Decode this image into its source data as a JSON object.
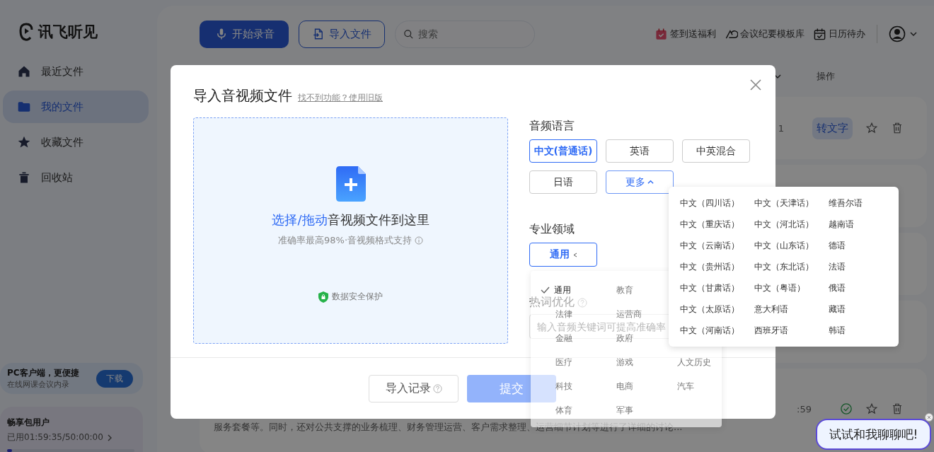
{
  "app": {
    "logo_text": "讯飞听见"
  },
  "sidebar": {
    "items": [
      {
        "label": "最近文件",
        "selected": false
      },
      {
        "label": "我的文件",
        "selected": true
      },
      {
        "label": "收藏文件",
        "selected": false
      },
      {
        "label": "回收站",
        "selected": false
      }
    ],
    "promo": {
      "title": "PC客户端，更便捷",
      "subtitle": "在线网课会议内录",
      "button": "下载"
    },
    "plan": {
      "title": "畅享包用户",
      "usage": "已用01:59:35/50:00:00",
      "level": 0.04
    }
  },
  "toolbar": {
    "record_button": "开始录音",
    "import_button": "导入文件",
    "search": {
      "placeholder": "搜索"
    },
    "links": [
      "签到送福利",
      "会议纪要模板库",
      "日历待办"
    ]
  },
  "table": {
    "action_header": "操作",
    "rows": [
      {
        "kind": "convert",
        "time": "1",
        "convert_label": "转文字"
      },
      {
        "kind": "done",
        "time": ":59",
        "description": "服务套餐等。同时，还对公共支撑的业务梳理、财务管理运营、客户需求整理、运营细节计划等进行了详细的讨论..."
      }
    ]
  },
  "modal": {
    "title": "导入音视频文件",
    "old_version_link": "找不到功能？使用旧版",
    "dropzone": {
      "action_text": "选择/拖动",
      "rest_text": "音视频文件到这里",
      "hint": "准确率最高98%·音视频格式支持",
      "security": "数据安全保护"
    },
    "language": {
      "label": "音频语言",
      "options": [
        {
          "label": "中文(普通话)",
          "selected": true
        },
        {
          "label": "英语",
          "selected": false
        },
        {
          "label": "中英混合",
          "selected": false
        },
        {
          "label": "日语",
          "selected": false
        }
      ],
      "more": {
        "label": "更多",
        "expanded": true
      }
    },
    "language_menu": [
      "中文（四川话）",
      "中文（天津话）",
      "维吾尔语",
      "中文（重庆话）",
      "中文（河北话）",
      "越南语",
      "中文（云南话）",
      "中文（山东话）",
      "德语",
      "中文（贵州话）",
      "中文（东北话）",
      "法语",
      "中文（甘肃话）",
      "中文（粤语）",
      "俄语",
      "中文（太原话）",
      "意大利语",
      "藏语",
      "中文（河南话）",
      "西班牙语",
      "韩语"
    ],
    "domain": {
      "label": "专业领域",
      "value": "通用",
      "expanded": true
    },
    "domain_menu": [
      [
        {
          "label": "通用",
          "selected": true
        },
        {
          "label": "教育",
          "selected": false
        }
      ],
      [
        {
          "label": "法律",
          "selected": false
        },
        {
          "label": "运营商",
          "selected": false
        }
      ],
      [
        {
          "label": "金融",
          "selected": false
        },
        {
          "label": "政府",
          "selected": false
        }
      ],
      [
        {
          "label": "医疗",
          "selected": false
        },
        {
          "label": "游戏",
          "selected": false
        },
        {
          "label": "人文历史",
          "selected": false
        }
      ],
      [
        {
          "label": "科技",
          "selected": false
        },
        {
          "label": "电商",
          "selected": false
        },
        {
          "label": "汽车",
          "selected": false
        }
      ],
      [
        {
          "label": "体育",
          "selected": false
        },
        {
          "label": "军事",
          "selected": false
        }
      ]
    ],
    "hotwords": {
      "label": "热词优化",
      "placeholder": "输入音频关键词可提高准确率"
    },
    "footer": {
      "history_button": "导入记录",
      "submit_button": "提交",
      "submit_disabled": true
    }
  },
  "chat_bubble": {
    "text": "试试和我聊聊吧!"
  }
}
